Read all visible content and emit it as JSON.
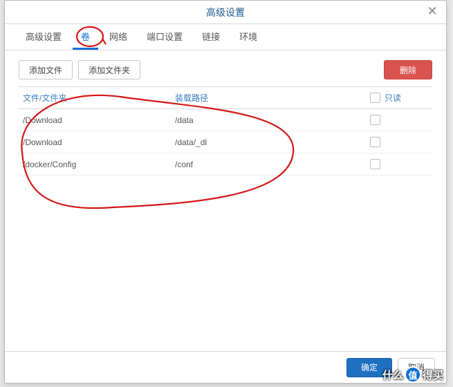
{
  "dialog": {
    "title": "高级设置"
  },
  "tabs": [
    {
      "label": "高级设置",
      "active": false
    },
    {
      "label": "卷",
      "active": true
    },
    {
      "label": "网络",
      "active": false
    },
    {
      "label": "端口设置",
      "active": false
    },
    {
      "label": "链接",
      "active": false
    },
    {
      "label": "环境",
      "active": false
    }
  ],
  "toolbar": {
    "add_file": "添加文件",
    "add_folder": "添加文件夹",
    "delete": "删除"
  },
  "grid": {
    "headers": {
      "path": "文件/文件夹",
      "mount": "装载路径",
      "readonly": "只读"
    },
    "rows": [
      {
        "path": "/Download",
        "mount": "/data",
        "readonly": false
      },
      {
        "path": "/Download",
        "mount": "/data/_dl",
        "readonly": false
      },
      {
        "path": "/docker/Config",
        "mount": "/conf",
        "readonly": false
      }
    ]
  },
  "footer": {
    "ok": "确定",
    "cancel": "取消"
  },
  "watermark": {
    "before": "什么",
    "badge": "值",
    "after": "得买"
  }
}
